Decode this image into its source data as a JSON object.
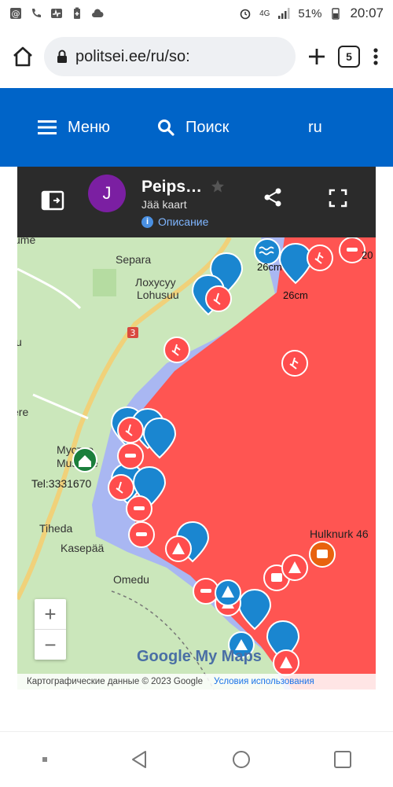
{
  "status": {
    "battery": "51%",
    "time": "20:07",
    "network": "4G"
  },
  "browser": {
    "url": "politsei.ee/ru/so:",
    "tab_count": "5"
  },
  "site_header": {
    "menu_label": "Меню",
    "search_label": "Поиск",
    "lang_label": "ru"
  },
  "map": {
    "title": "Peips…",
    "subtitle": "Jää kaart",
    "description_label": "Описание",
    "avatar_letter": "J",
    "places": {
      "separa": "Separa",
      "lohusuu_ru": "Лохусуу",
      "lohusuu": "Lohusuu",
      "road": "3",
      "edge1": "ere",
      "edge2": "u",
      "edge3": "ume",
      "mustvee_ru": "Мустве",
      "mustvee": "Mustvee",
      "tel": "Tel:3331670",
      "tiheda": "Tiheda",
      "kasepaa": "Kasepää",
      "omedu": "Omedu",
      "hulknurk": "Hulknurk 46"
    },
    "ice_labels": {
      "a": "26cm",
      "b": "26cm",
      "c": "20"
    },
    "zoom_in": "+",
    "zoom_out": "−",
    "logo": "Google My Maps",
    "attribution": "Картографические данные © 2023 Google",
    "terms": "Условия использования"
  },
  "icons": {
    "back": "triangle-back-icon",
    "home": "circle-home-icon",
    "recents": "square-recents-icon"
  }
}
